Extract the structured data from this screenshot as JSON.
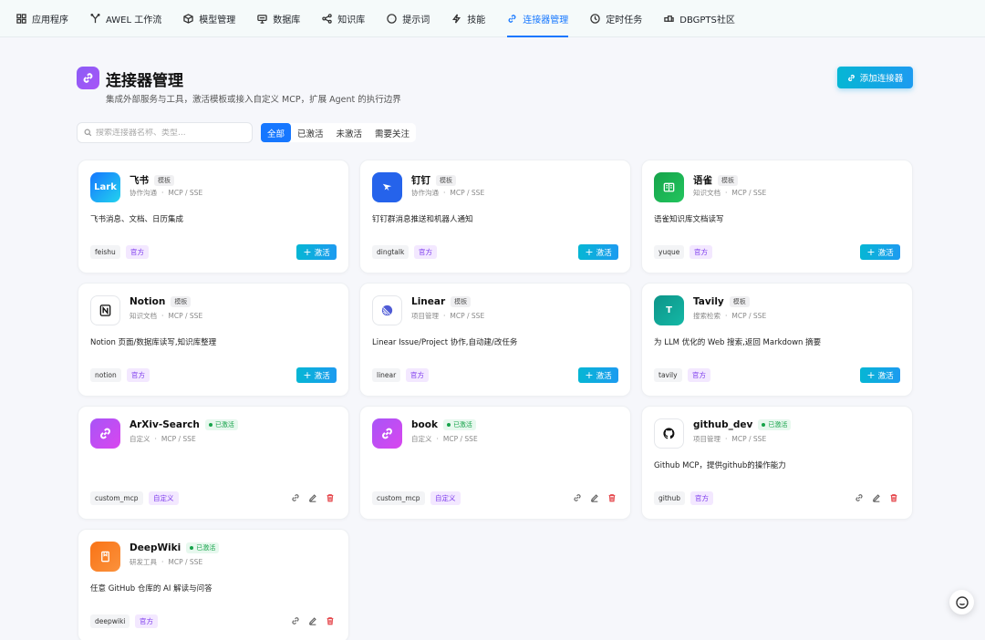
{
  "nav": {
    "items": [
      {
        "label": "应用程序",
        "icon": "grid-icon"
      },
      {
        "label": "AWEL 工作流",
        "icon": "workflow-icon"
      },
      {
        "label": "模型管理",
        "icon": "cube-icon"
      },
      {
        "label": "数据库",
        "icon": "database-icon"
      },
      {
        "label": "知识库",
        "icon": "share-icon"
      },
      {
        "label": "提示词",
        "icon": "chat-icon"
      },
      {
        "label": "技能",
        "icon": "lightning-icon"
      },
      {
        "label": "连接器管理",
        "icon": "link-icon",
        "active": true
      },
      {
        "label": "定时任务",
        "icon": "clock-icon"
      },
      {
        "label": "DBGPTS社区",
        "icon": "community-icon"
      }
    ],
    "active_color": "#1677ff"
  },
  "header": {
    "title": "连接器管理",
    "subtitle": "集成外部服务与工具，激活模板或接入自定义 MCP，扩展 Agent 的执行边界",
    "add_button": "添加连接器"
  },
  "toolbar": {
    "search_placeholder": "搜索连接器名称、类型...",
    "filters": [
      "全部",
      "已激活",
      "未激活",
      "需要关注"
    ],
    "active_filter": "全部"
  },
  "labels": {
    "template_badge": "模板",
    "active_badge": "已激活",
    "activate_button": "激活",
    "activate_plus": "+"
  },
  "connectors": [
    {
      "name": "飞书",
      "status": "template",
      "category": "协作沟通",
      "transport": "MCP / SSE",
      "desc": "飞书消息、文档、日历集成",
      "id": "feishu",
      "kind": "官方",
      "logo": "lark-logo",
      "logo_text": "Lark",
      "logo_color": "#1e88e5"
    },
    {
      "name": "钉钉",
      "status": "template",
      "category": "协作沟通",
      "transport": "MCP / SSE",
      "desc": "钉钉群消息推送和机器人通知",
      "id": "dingtalk",
      "kind": "官方",
      "logo": "dingtalk-logo",
      "logo_text": "",
      "logo_color": "#2563eb"
    },
    {
      "name": "语雀",
      "status": "template",
      "category": "知识文档",
      "transport": "MCP / SSE",
      "desc": "语雀知识库文档读写",
      "id": "yuque",
      "kind": "官方",
      "logo": "yuque-logo",
      "logo_text": "",
      "logo_color": "#16a34a"
    },
    {
      "name": "Notion",
      "status": "template",
      "category": "知识文档",
      "transport": "MCP / SSE",
      "desc": "Notion 页面/数据库读写,知识库整理",
      "id": "notion",
      "kind": "官方",
      "logo": "notion-logo",
      "logo_text": "N",
      "logo_color": "#ffffff"
    },
    {
      "name": "Linear",
      "status": "template",
      "category": "项目管理",
      "transport": "MCP / SSE",
      "desc": "Linear Issue/Project 协作,自动建/改任务",
      "id": "linear",
      "kind": "官方",
      "logo": "linear-logo",
      "logo_text": "",
      "logo_color": "#ffffff"
    },
    {
      "name": "Tavily",
      "status": "template",
      "category": "搜索检索",
      "transport": "MCP / SSE",
      "desc": "为 LLM 优化的 Web 搜索,返回 Markdown 摘要",
      "id": "tavily",
      "kind": "官方",
      "logo": "tavily-logo",
      "logo_text": "T",
      "logo_color": "#0d9488"
    },
    {
      "name": "ArXiv-Search",
      "status": "active",
      "category": "自定义",
      "transport": "MCP / SSE",
      "desc": "",
      "id": "custom_mcp",
      "kind": "自定义",
      "logo": "link-icon",
      "logo_text": "",
      "logo_color": "#a855f7"
    },
    {
      "name": "book",
      "status": "active",
      "category": "自定义",
      "transport": "MCP / SSE",
      "desc": "",
      "id": "custom_mcp",
      "kind": "自定义",
      "logo": "link-icon",
      "logo_text": "",
      "logo_color": "#a855f7"
    },
    {
      "name": "github_dev",
      "status": "active",
      "category": "项目管理",
      "transport": "MCP / SSE",
      "desc": "Github MCP，提供github的操作能力",
      "id": "github",
      "kind": "官方",
      "logo": "github-logo",
      "logo_text": "",
      "logo_color": "#ffffff"
    },
    {
      "name": "DeepWiki",
      "status": "active",
      "category": "研发工具",
      "transport": "MCP / SSE",
      "desc": "任意 GitHub 仓库的 AI 解读与问答",
      "id": "deepwiki",
      "kind": "官方",
      "logo": "deepwiki-logo",
      "logo_text": "",
      "logo_color": "#f97316"
    }
  ],
  "meta_separator": "·",
  "help": {
    "icon": "smile-icon"
  }
}
